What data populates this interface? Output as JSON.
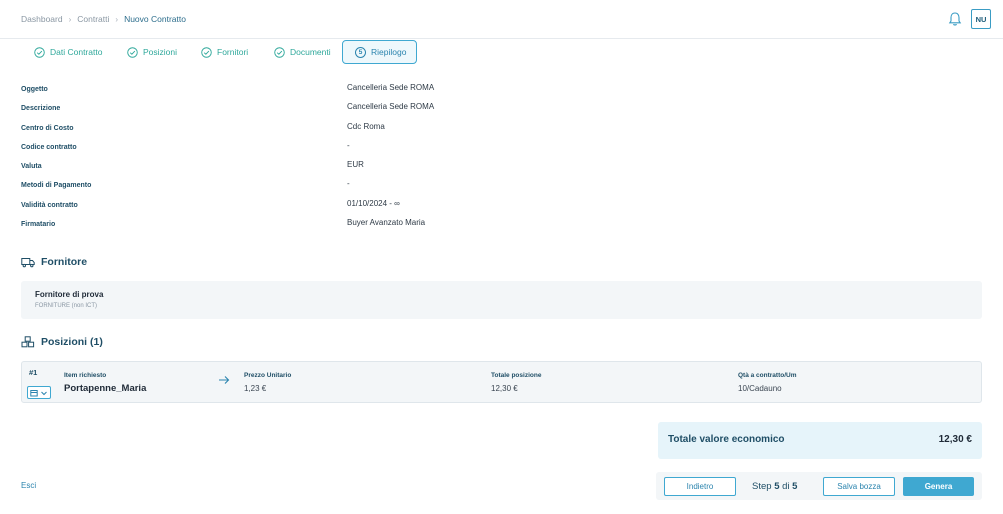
{
  "breadcrumb": {
    "items": [
      "Dashboard",
      "Contratti",
      "Nuovo Contratto"
    ]
  },
  "header": {
    "avatar_initials": "NU",
    "bell_icon": "bell-icon"
  },
  "steps": [
    {
      "label": "Dati Contratto",
      "state": "done"
    },
    {
      "label": "Posizioni",
      "state": "done"
    },
    {
      "label": "Fornitori",
      "state": "done"
    },
    {
      "label": "Documenti",
      "state": "done"
    },
    {
      "label": "Riepilogo",
      "state": "active",
      "number": "5"
    }
  ],
  "summary": [
    {
      "label": "Oggetto",
      "value": "Cancelleria Sede ROMA"
    },
    {
      "label": "Descrizione",
      "value": "Cancelleria Sede ROMA"
    },
    {
      "label": "Centro di Costo",
      "value": "Cdc Roma"
    },
    {
      "label": "Codice contratto",
      "value": "-"
    },
    {
      "label": "Valuta",
      "value": "EUR"
    },
    {
      "label": "Metodi di Pagamento",
      "value": "-"
    },
    {
      "label": "Validità contratto",
      "value": "01/10/2024 - ∞"
    },
    {
      "label": "Firmatario",
      "value": "Buyer Avanzato Maria"
    }
  ],
  "supplier_section": {
    "title": "Fornitore",
    "name": "Fornitore di prova",
    "category": "FORNITURE (non ICT)"
  },
  "positions_section": {
    "title": "Posizioni (1)",
    "items": [
      {
        "index": "#1",
        "item_label": "Item richiesto",
        "item_value": "Portapenne_Maria",
        "price_label": "Prezzo Unitario",
        "price_value": "1,23 €",
        "total_label": "Totale posizione",
        "total_value": "12,30 €",
        "qty_label": "Qtà a contratto/Um",
        "qty_value": "10/Cadauno"
      }
    ]
  },
  "total": {
    "label": "Totale valore economico",
    "value": "12,30 €"
  },
  "footer": {
    "exit_label": "Esci",
    "back_label": "Indietro",
    "step_prefix": "Step",
    "step_current": "5",
    "step_of": "di",
    "step_total": "5",
    "draft_label": "Salva bozza",
    "generate_label": "Genera"
  },
  "colors": {
    "accent": "#3fa8d1",
    "done": "#2fa89b",
    "heading": "#1f4e66"
  }
}
